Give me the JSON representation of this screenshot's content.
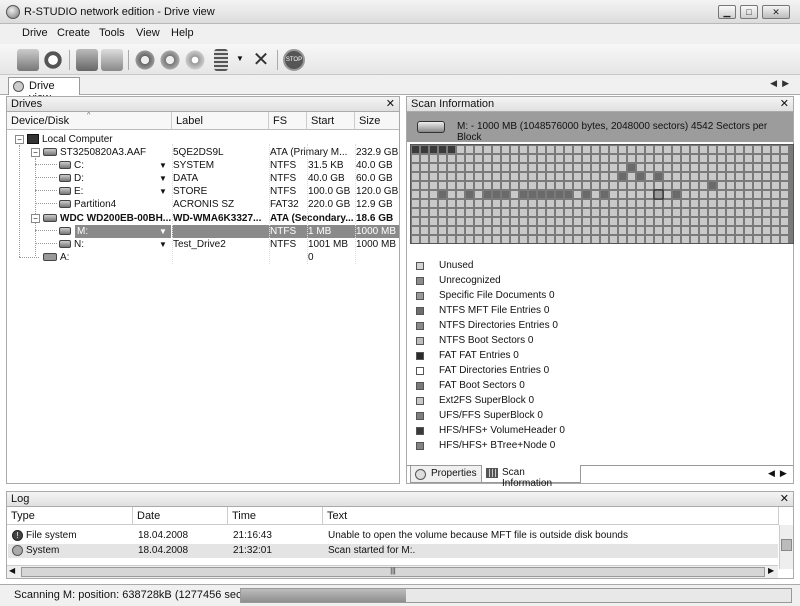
{
  "window": {
    "title": "R-STUDIO network edition - Drive view"
  },
  "menu": [
    {
      "label": "Drive"
    },
    {
      "label": "Create"
    },
    {
      "label": "Tools"
    },
    {
      "label": "View"
    },
    {
      "label": "Help"
    }
  ],
  "tabs": {
    "active": "Drive view"
  },
  "drives_panel": {
    "title": "Drives",
    "columns": [
      "Device/Disk",
      "Label",
      "FS",
      "Start",
      "Size"
    ],
    "rows": [
      {
        "device": "Local Computer",
        "label": "",
        "fs": "",
        "start": "",
        "size": ""
      },
      {
        "device": "ST3250820A3.AAF",
        "label": "5QE2DS9L",
        "fs": "ATA (Primary M...",
        "start": "",
        "size": "232.9 GB"
      },
      {
        "device": "C:",
        "label": "SYSTEM",
        "fs": "NTFS",
        "start": "31.5 KB",
        "size": "40.0 GB"
      },
      {
        "device": "D:",
        "label": "DATA",
        "fs": "NTFS",
        "start": "40.0 GB",
        "size": "60.0 GB"
      },
      {
        "device": "E:",
        "label": "STORE",
        "fs": "NTFS",
        "start": "100.0 GB",
        "size": "120.0 GB"
      },
      {
        "device": "Partition4",
        "label": "ACRONIS SZ",
        "fs": "FAT32",
        "start": "220.0 GB",
        "size": "12.9 GB"
      },
      {
        "device": "WDC WD200EB-00BH...",
        "label": "WD-WMA6K3327...",
        "fs": "ATA (Secondary...",
        "start": "",
        "size": "18.6 GB"
      },
      {
        "device": "M:",
        "label": "",
        "fs": "NTFS",
        "start": "1 MB",
        "size": "1000 MB"
      },
      {
        "device": "N:",
        "label": "Test_Drive2",
        "fs": "NTFS",
        "start": "1001 MB",
        "size": "1000 MB"
      },
      {
        "device": "A:",
        "label": "",
        "fs": "",
        "start": "0",
        "size": ""
      }
    ]
  },
  "scan_panel": {
    "title": "Scan Information",
    "drive_info": "M: - 1000 MB (1048576000 bytes, 2048000 sectors)  4542 Sectors per Block",
    "legend": [
      {
        "label": "Unused",
        "color": "#d4d4d4"
      },
      {
        "label": "Unrecognized",
        "color": "#8c8c8c"
      },
      {
        "label": "Specific File Documents 0",
        "color": "#9a9a9a"
      },
      {
        "label": "NTFS MFT File Entries 0",
        "color": "#6e6e6e"
      },
      {
        "label": "NTFS Directories Entries 0",
        "color": "#8a8a8a"
      },
      {
        "label": "NTFS Boot Sectors 0",
        "color": "#bdbdbd"
      },
      {
        "label": "FAT FAT Entries 0",
        "color": "#2a2a2a"
      },
      {
        "label": "FAT Directories Entries 0",
        "color": "#ffffff"
      },
      {
        "label": "FAT Boot Sectors 0",
        "color": "#7a7a7a"
      },
      {
        "label": "Ext2FS SuperBlock 0",
        "color": "#c8c8c8"
      },
      {
        "label": "UFS/FFS SuperBlock 0",
        "color": "#7e7e7e"
      },
      {
        "label": "HFS/HFS+ VolumeHeader 0",
        "color": "#3a3a3a"
      },
      {
        "label": "HFS/HFS+ BTree+Node 0",
        "color": "#848484"
      }
    ],
    "tabs": [
      "Properties",
      "Scan Information"
    ]
  },
  "log_panel": {
    "title": "Log",
    "columns": [
      "Type",
      "Date",
      "Time",
      "Text"
    ],
    "rows": [
      {
        "type": "File system",
        "date": "18.04.2008",
        "time": "21:16:43",
        "text": "Unable to open the volume because MFT file is outside disk bounds"
      },
      {
        "type": "System",
        "date": "18.04.2008",
        "time": "21:32:01",
        "text": "Scan started for M:."
      }
    ]
  },
  "status": {
    "text": "Scanning M: position: 638728kB (1277456 sector)",
    "progress": 0.3
  }
}
